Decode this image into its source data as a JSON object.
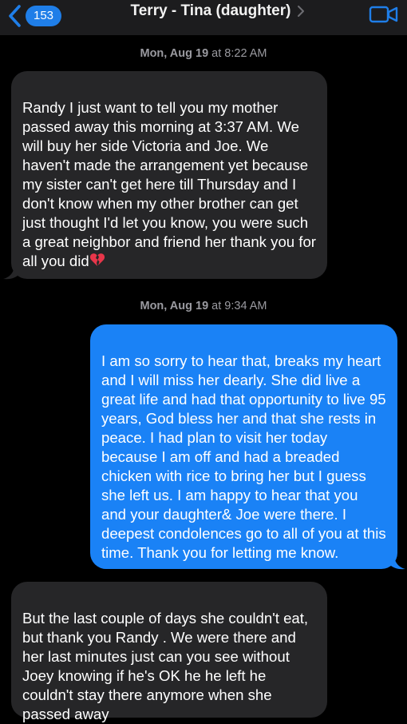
{
  "header": {
    "back_count": "153",
    "contact_name": "Terry - Tina (daughter)",
    "back_icon": "chevron-left-icon",
    "video_icon": "video-camera-icon",
    "accent": "#1f7ee8",
    "bar_bg": "#1c1c1e"
  },
  "conversation": {
    "timestamps": [
      {
        "day": "Mon, Aug 19",
        "time": "at 8:22 AM"
      },
      {
        "day": "Mon, Aug 19",
        "time": "at 9:34 AM"
      }
    ],
    "messages": [
      {
        "direction": "incoming",
        "text": "Randy I just want to tell you my mother passed away this morning at 3:37 AM. We will buy her side Victoria and Joe. We haven't made the arrangement yet because my sister can't get here till Thursday and I don't know when my other brother can get just thought I'd let you know, you were such a great neighbor and friend her thank you for all you did",
        "emoji": "broken-heart-icon"
      },
      {
        "direction": "outgoing",
        "text": "I am so sorry to hear that, breaks my heart and I will miss her dearly. She did live a great life and had that opportunity to live 95 years, God bless her and that she rests in peace. I had plan to visit her today because I am off and had a breaded chicken with rice to bring her but I guess she left us. I am happy to hear that you and your daughter& Joe were there. I deepest condolences go to all of you at this time. Thank you for letting me know."
      },
      {
        "direction": "incoming",
        "text": "But the last couple of days she couldn't eat, but thank you Randy . We were there and her last minutes just can you see without Joey knowing if he's OK he he left he couldn't stay there anymore when she passed away"
      }
    ],
    "colors": {
      "incoming": "#262628",
      "outgoing": "#1a82f6",
      "timestamp": "#9a9aa0"
    }
  }
}
